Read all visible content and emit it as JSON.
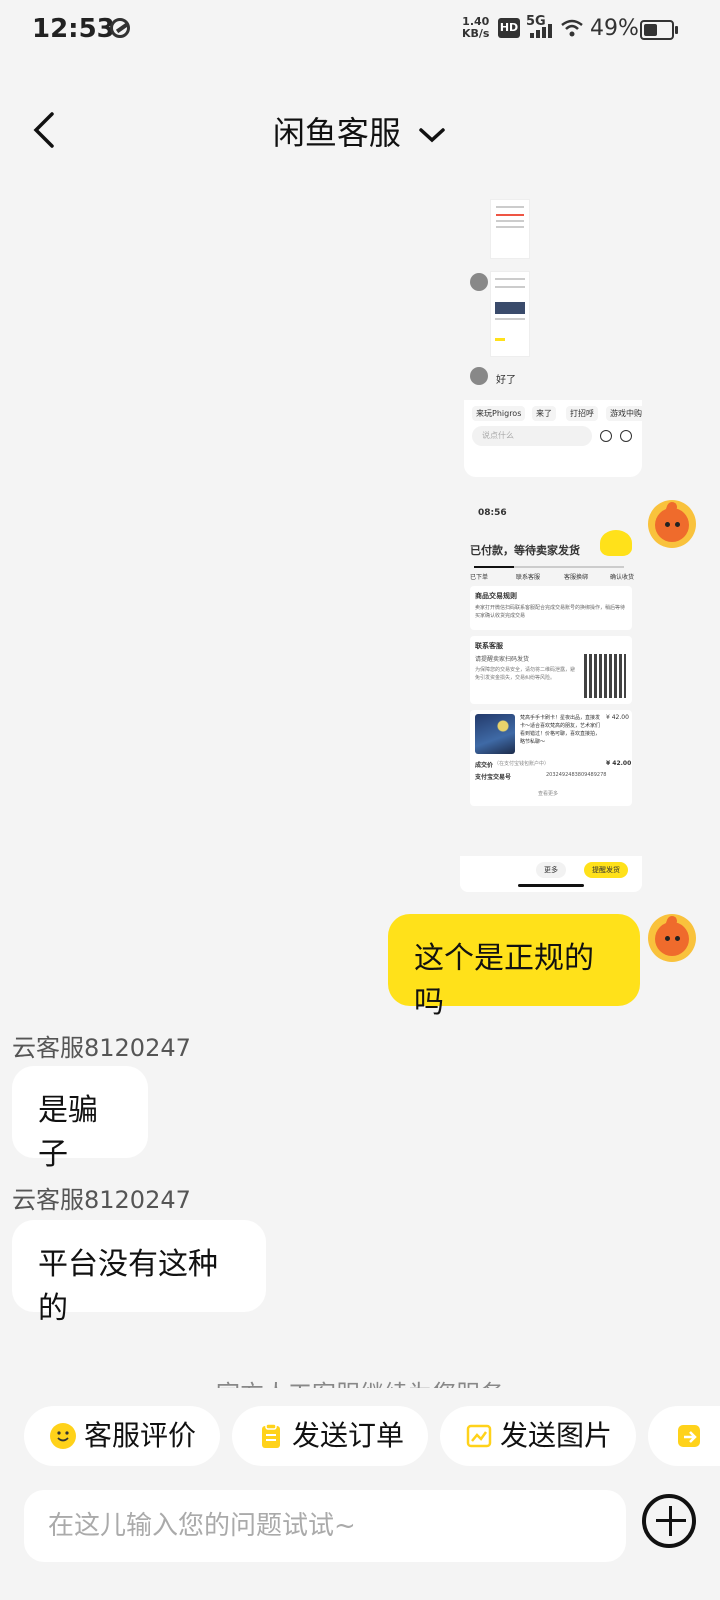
{
  "status_bar": {
    "time": "12:53",
    "net_speed": "1.40",
    "net_unit": "KB/s",
    "hd": "HD",
    "network": "5G",
    "battery_pct": "49%",
    "battery_level": 0.49
  },
  "header": {
    "title": "闲鱼客服"
  },
  "screenshot1": {
    "reply": "好了",
    "quick_tags": [
      "来玩Phigros",
      "来了",
      "打招呼",
      "游戏中购"
    ],
    "input_placeholder": "说点什么"
  },
  "screenshot2": {
    "time": "08:56",
    "order_status": "已付款，等待卖家发货",
    "steps": [
      "已下单",
      "联系客服",
      "客服换绑",
      "确认收货"
    ],
    "rules_title": "商品交易规则",
    "rules_text": "卖家打开微信扫码联系客服配合完成交易账号的换绑操作，稍后等待买家确认收货完成交易",
    "contact_title": "联系客服",
    "contact_sub": "请提醒卖家扫码发货",
    "contact_text": "为保障您的交易安全，请勿将二维码泄露，避免引发资金损失，交易纠纷等风险。",
    "product_desc": "梵高手手卡刷卡！星夜出品，直接发卡～适合喜欢梵高的朋友，艺术家们看到错过！价格可聊，喜欢直接拍，略节私聊～",
    "product_price": "¥ 42.00",
    "paid_label": "成交价",
    "paid_note": "（在支付宝钱包账户中）",
    "paid_price": "¥ 42.00",
    "alipay_label": "支付宝交易号",
    "alipay_no": "2032492483809489278",
    "view_more": "查看更多",
    "btn_more": "更多",
    "btn_remind": "提醒发货"
  },
  "messages": [
    {
      "from": "me",
      "text": "这个是正规的吗"
    },
    {
      "from": "agent",
      "agent": "云客服8120247",
      "text": "是骗子"
    },
    {
      "from": "agent",
      "agent": "云客服8120247",
      "text": "平台没有这种的"
    }
  ],
  "service_note": "官方人工客服继续为您服务",
  "quick_actions": [
    {
      "label": "客服评价",
      "icon": "smile-icon"
    },
    {
      "label": "发送订单",
      "icon": "clipboard-icon"
    },
    {
      "label": "发送图片",
      "icon": "image-icon"
    }
  ],
  "input": {
    "placeholder": "在这儿输入您的问题试试~"
  },
  "colors": {
    "accent": "#ffe11a",
    "background": "#f4f4f4"
  }
}
